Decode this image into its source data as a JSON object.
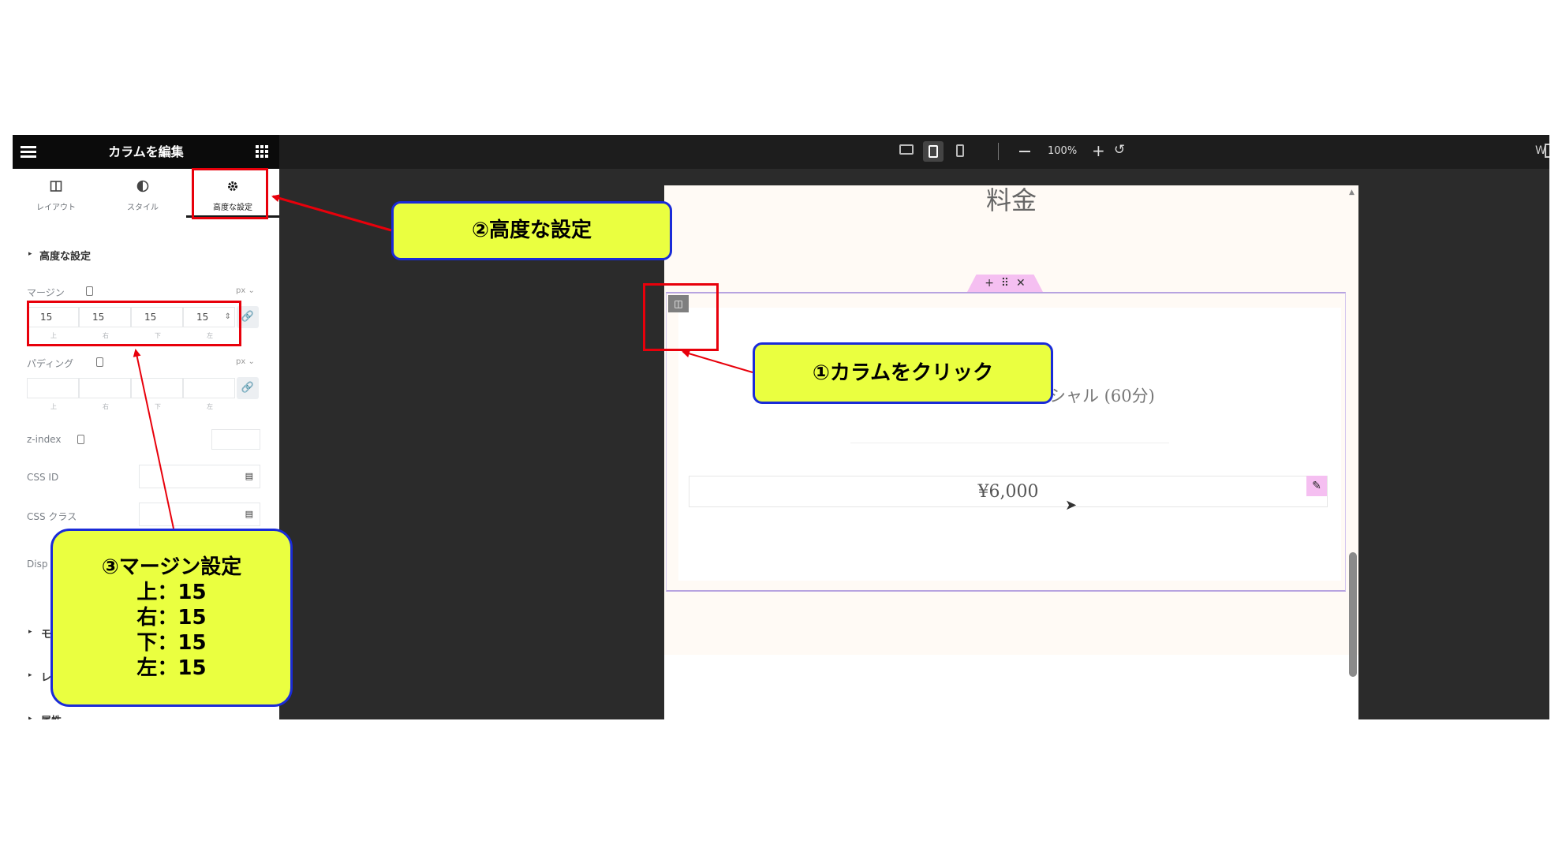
{
  "panel": {
    "title": "カラムを編集",
    "tabs": [
      {
        "label": "レイアウト",
        "icon": "layout-icon"
      },
      {
        "label": "スタイル",
        "icon": "contrast-icon"
      },
      {
        "label": "高度な設定",
        "icon": "gear-icon"
      }
    ],
    "section_title": "高度な設定",
    "margin": {
      "label": "マージン",
      "unit": "px",
      "top": "15",
      "right": "15",
      "bottom": "15",
      "left": "15",
      "sub_labels": [
        "上",
        "右",
        "下",
        "左"
      ]
    },
    "padding": {
      "label": "パディング",
      "unit": "px",
      "sub_labels": [
        "上",
        "右",
        "下",
        "左"
      ]
    },
    "zindex_label": "z-index",
    "css_id_label": "CSS ID",
    "css_class_label": "CSS クラス",
    "display_label_partial": "Disp",
    "collapsed_sections_partial": [
      "モ",
      "レ",
      "属性"
    ]
  },
  "toolbar": {
    "zoom": "100%",
    "right_partial": "W"
  },
  "preview": {
    "heading": "料金",
    "menu_partial": "シャル (60分)",
    "price": "¥6,000"
  },
  "callouts": {
    "c1": "①カラムをクリック",
    "c2": "②高度な設定",
    "c3_title": "③マージン設定",
    "c3_lines": [
      "上：15",
      "右：15",
      "下：15",
      "左：15"
    ]
  },
  "colors": {
    "callout_bg": "#eaff40",
    "callout_border": "#1a2bd8",
    "highlight_red": "#e8000b",
    "elementor_pink": "#f5bff1",
    "column_outline": "#b7a3e0"
  }
}
